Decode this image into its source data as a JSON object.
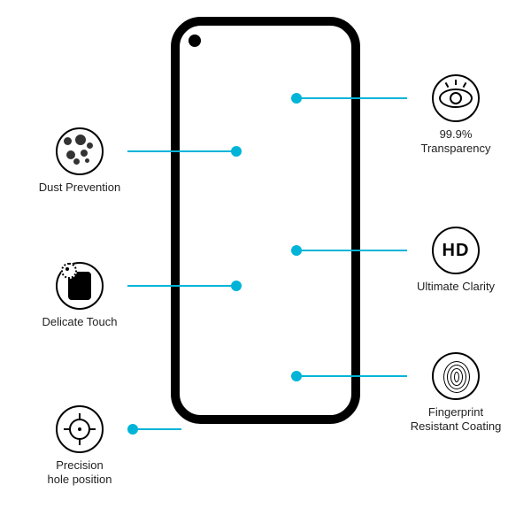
{
  "features_left": [
    {
      "id": "dust-prevention",
      "label": "Dust Prevention"
    },
    {
      "id": "delicate-touch",
      "label": "Delicate Touch"
    },
    {
      "id": "precision-hole-position",
      "label": "Precision\nhole position"
    }
  ],
  "features_right": [
    {
      "id": "transparency",
      "label": "99.9%\nTransparency"
    },
    {
      "id": "ultimate-clarity",
      "label": "Ultimate Clarity",
      "icon_text": "HD"
    },
    {
      "id": "fingerprint-resistant",
      "label": "Fingerprint\nResistant Coating"
    }
  ],
  "accent_color": "#00b4d8"
}
